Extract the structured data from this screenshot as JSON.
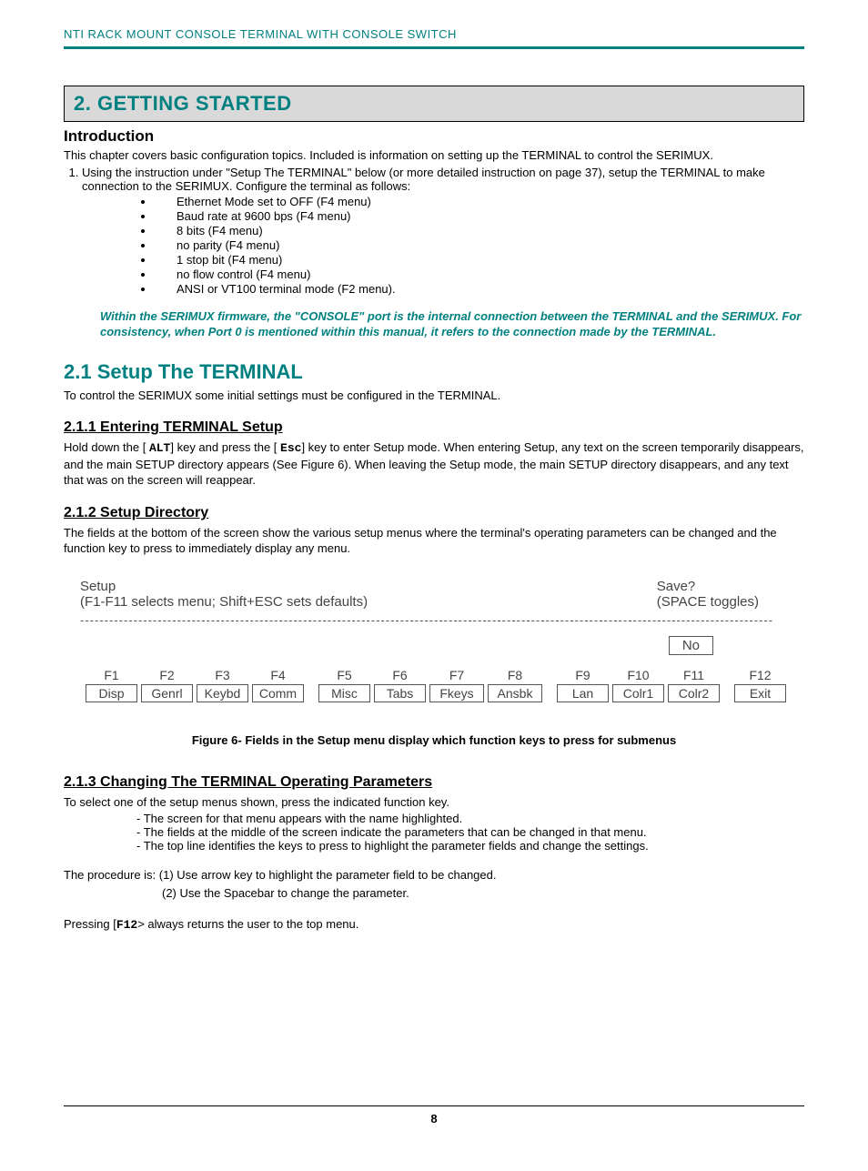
{
  "header": {
    "product_line": "NTI RACK MOUNT CONSOLE TERMINAL WITH CONSOLE SWITCH"
  },
  "chapter": {
    "title": "2. GETTING STARTED"
  },
  "intro": {
    "heading": "Introduction",
    "para": "This chapter covers basic configuration topics.  Included is information on setting up the TERMINAL to control the SERIMUX.",
    "step1": "Using the instruction under \"Setup The TERMINAL\" below (or more detailed instruction on page 37), setup the TERMINAL to make connection to the SERIMUX.    Configure the terminal as follows:",
    "bullets": [
      "Ethernet Mode set to OFF (F4 menu)",
      "Baud rate at 9600 bps (F4 menu)",
      "8 bits (F4 menu)",
      "no parity (F4 menu)",
      "1 stop bit (F4 menu)",
      "no flow control (F4 menu)",
      "ANSI or VT100 terminal mode (F2 menu)."
    ],
    "note": "Within the SERIMUX firmware, the \"CONSOLE\" port is the internal connection between the TERMINAL and the SERIMUX.    For consistency, when Port 0 is mentioned within this manual, it refers to the connection made by the TERMINAL."
  },
  "s21": {
    "heading": "2.1 Setup The TERMINAL",
    "para": "To control the SERIMUX some initial settings must be configured in the TERMINAL."
  },
  "s211": {
    "heading": "2.1.1 Entering TERMINAL Setup",
    "text_before_alt": "Hold down the [ ",
    "alt": "ALT",
    "text_mid": "] key and press the [ ",
    "esc": "Esc",
    "text_after": "] key to enter Setup mode.  When entering Setup, any text on the screen temporarily disappears, and the main SETUP directory appears (See Figure 6). When leaving the Setup mode, the main SETUP directory disappears, and any text that was on the screen will reappear."
  },
  "s212": {
    "heading": "2.1.2 Setup Directory",
    "para": "The fields at the bottom of the screen show the various setup menus where the terminal's operating parameters can be changed and the function key to press to immediately display any menu."
  },
  "setup_panel": {
    "left_title": "Setup",
    "left_sub": "(F1-F11 selects menu; Shift+ESC sets defaults)",
    "right_title": "Save?",
    "right_sub": "(SPACE toggles)",
    "no_label": "No",
    "fkeys": [
      {
        "key": "F1",
        "label": "Disp"
      },
      {
        "key": "F2",
        "label": "Genrl"
      },
      {
        "key": "F3",
        "label": "Keybd"
      },
      {
        "key": "F4",
        "label": "Comm"
      },
      {
        "key": "F5",
        "label": "Misc"
      },
      {
        "key": "F6",
        "label": "Tabs"
      },
      {
        "key": "F7",
        "label": "Fkeys"
      },
      {
        "key": "F8",
        "label": "Ansbk"
      },
      {
        "key": "F9",
        "label": "Lan"
      },
      {
        "key": "F10",
        "label": "Colr1"
      },
      {
        "key": "F11",
        "label": "Colr2"
      },
      {
        "key": "F12",
        "label": "Exit"
      }
    ]
  },
  "figure_caption": "Figure 6- Fields in the Setup menu display which function keys to press for submenus",
  "s213": {
    "heading": "2.1.3 Changing The TERMINAL Operating Parameters",
    "para": "To select one of the setup menus shown, press the indicated function key.",
    "items": [
      "- The screen for that menu appears with the name highlighted.",
      "- The fields at the middle of the screen indicate the parameters that can be changed in that menu.",
      "- The top line identifies the keys to press to highlight the parameter fields and change the settings."
    ],
    "proc1": "The procedure is: (1) Use arrow key to highlight the parameter field to be changed.",
    "proc2": "(2) Use the Spacebar to change the parameter.",
    "press_before": "Pressing [",
    "f12": "F12",
    "press_after": "> always returns the user to the top menu."
  },
  "page_number": "8"
}
